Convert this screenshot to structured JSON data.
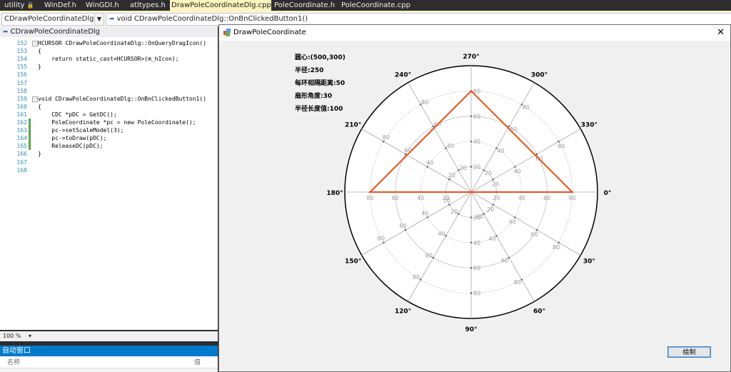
{
  "tabs": [
    {
      "label": "utility",
      "lock": true
    },
    {
      "label": "WinDef.h"
    },
    {
      "label": "WinGDI.h"
    },
    {
      "label": "atltypes.h"
    },
    {
      "label": "DrawPoleCoordinateDlg.cpp",
      "active": true,
      "close": "×"
    },
    {
      "label": "PoleCoordinate.h"
    },
    {
      "label": "PoleCoordinate.cpp"
    }
  ],
  "navbar": {
    "class_combo": "CDrawPoleCoordinateDlg",
    "method_combo": "void CDrawPoleCoordinateDlg::OnBnClickedButton1()"
  },
  "editor": {
    "class_title": "CDrawPoleCoordinateDlg",
    "lines": [
      {
        "n": "152",
        "text": "HCURSOR CDrawPoleCoordinateDlg::OnQueryDragIcon()"
      },
      {
        "n": "153",
        "text": "{"
      },
      {
        "n": "154",
        "text": "    return static_cast<HCURSOR>(m_hIcon);"
      },
      {
        "n": "155",
        "text": "}"
      },
      {
        "n": "156",
        "text": ""
      },
      {
        "n": "157",
        "text": ""
      },
      {
        "n": "158",
        "text": ""
      },
      {
        "n": "159",
        "text": "void CDrawPoleCoordinateDlg::OnBnClickedButton1()"
      },
      {
        "n": "160",
        "text": "{"
      },
      {
        "n": "161",
        "text": "    CDC *pDC = GetDC();"
      },
      {
        "n": "162",
        "text": "    PoleCoordinate *pc = new PoleCoordinate();"
      },
      {
        "n": "163",
        "text": "    pc->setScaleModel(3);"
      },
      {
        "n": "164",
        "text": "    pc->toDraw(pDC);"
      },
      {
        "n": "165",
        "text": "    ReleaseDC(pDC);"
      },
      {
        "n": "166",
        "text": "}"
      },
      {
        "n": "167",
        "text": ""
      },
      {
        "n": "168",
        "text": ""
      }
    ],
    "zoom": "100 %"
  },
  "auto_window": {
    "title": "自动窗口",
    "col_name": "名称",
    "col_value": "值"
  },
  "dialog": {
    "title": "DrawPoleCoordinate",
    "close_glyph": "✕",
    "info": [
      "圆心:(500,300)",
      "半径:250",
      "每环相隔距离:50",
      "扇形角度:30",
      "半径长度值:100"
    ],
    "draw_button": "绘制"
  },
  "chart_data": {
    "type": "polar",
    "angle_labels": [
      "0°",
      "30°",
      "60°",
      "90°",
      "120°",
      "150°",
      "180°",
      "210°",
      "240°",
      "270°",
      "300°",
      "330°"
    ],
    "ring_labels": [
      "20",
      "40",
      "60",
      "80"
    ],
    "radial_max": 100,
    "triangle": {
      "color": "#e8501e",
      "vertices": [
        {
          "angle": 270,
          "r": 80
        },
        {
          "angle": 0,
          "r": 80
        },
        {
          "angle": 180,
          "r": 80
        }
      ]
    }
  }
}
